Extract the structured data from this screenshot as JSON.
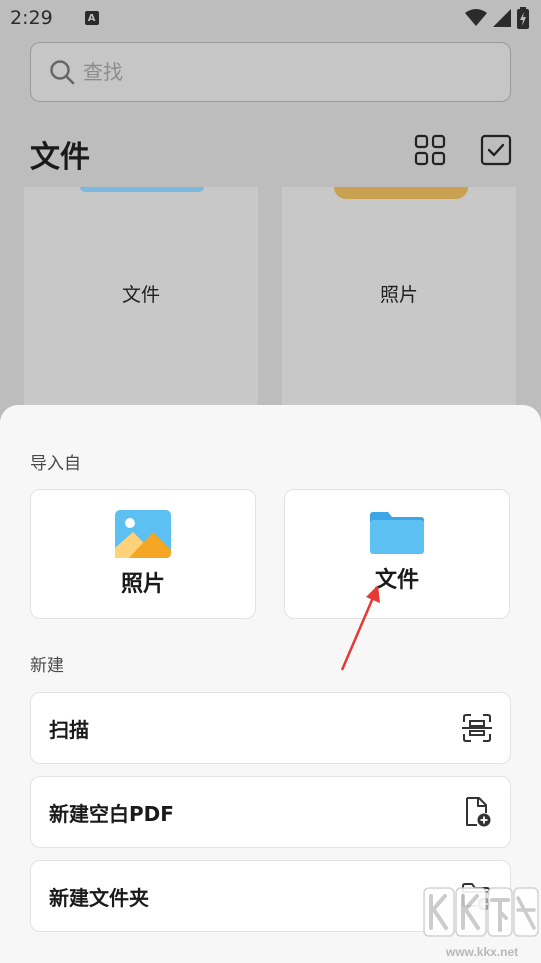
{
  "status_bar": {
    "time": "2:29",
    "notification_letter": "A"
  },
  "search": {
    "placeholder": "查找"
  },
  "header": {
    "title": "文件"
  },
  "folders": [
    {
      "label": "文件",
      "tab_color": "#7ab8de"
    },
    {
      "label": "照片",
      "tab_color": "#c9a151"
    }
  ],
  "sheet": {
    "import_label": "导入自",
    "import_options": [
      {
        "label": "照片",
        "icon": "photo-icon"
      },
      {
        "label": "文件",
        "icon": "folder-icon"
      }
    ],
    "new_label": "新建",
    "new_options": [
      {
        "label": "扫描",
        "icon": "scan-icon"
      },
      {
        "label": "新建空白PDF",
        "icon": "new-pdf-icon"
      },
      {
        "label": "新建文件夹",
        "icon": "new-folder-icon"
      }
    ]
  },
  "watermark": {
    "brand": "KK下载",
    "url": "www.kkx.net"
  },
  "colors": {
    "accent_blue": "#4fb3ef",
    "annotation_red": "#e53935",
    "scrim": "#bdbdbd"
  }
}
